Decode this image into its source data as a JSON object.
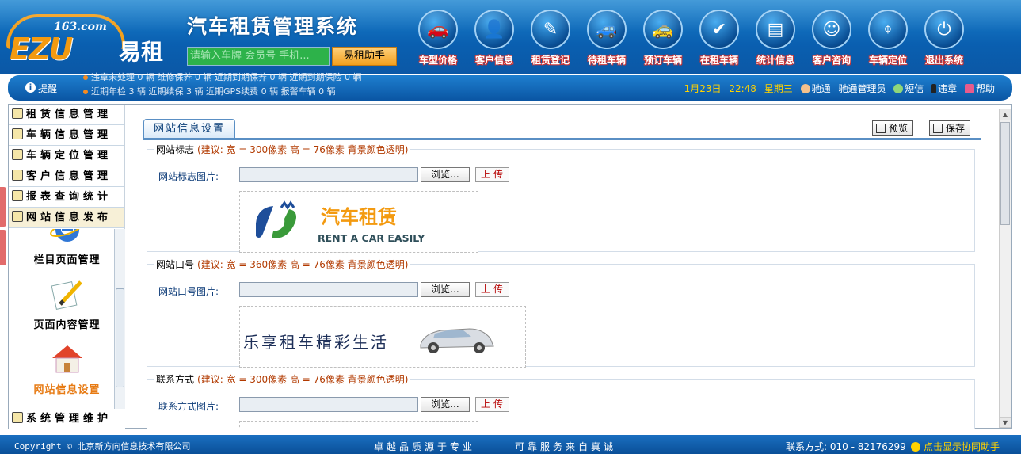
{
  "header": {
    "logo_domain": "163.com",
    "logo_brand": "EZU",
    "logo_name": "易租",
    "system_title": "汽车租赁管理系统",
    "search_placeholder": "请输入车牌 会员号 手机...",
    "helper_button": "易租助手"
  },
  "nav": [
    {
      "label": "车型价格",
      "icon": "car-price-icon"
    },
    {
      "label": "客户信息",
      "icon": "customer-info-icon"
    },
    {
      "label": "租赁登记",
      "icon": "rental-register-icon"
    },
    {
      "label": "待租车辆",
      "icon": "car-waiting-icon"
    },
    {
      "label": "预订车辆",
      "icon": "car-booking-icon"
    },
    {
      "label": "在租车辆",
      "icon": "car-rented-icon"
    },
    {
      "label": "统计信息",
      "icon": "statistics-icon"
    },
    {
      "label": "客户咨询",
      "icon": "consult-icon"
    },
    {
      "label": "车辆定位",
      "icon": "car-locate-icon"
    },
    {
      "label": "退出系统",
      "icon": "exit-icon"
    }
  ],
  "notice": {
    "label": "提醒",
    "line1": "违章未处理 0 辆  维修保养 0 辆  近期到期保养 0 辆  近期到期保险 0 辆",
    "line2": "近期年检 3 辆  近期续保 3 辆  近期GPS续费 0 辆  报警车辆 0 辆",
    "date": "1月23日",
    "time": "22:48",
    "weekday": "星期三",
    "user_org": "驰通",
    "user_name": "驰通管理员",
    "sms": "短信",
    "violation": "违章",
    "help": "帮助"
  },
  "sidebar": {
    "items": [
      "租赁信息管理",
      "车辆信息管理",
      "车辆定位管理",
      "客户信息管理",
      "报表查询统计",
      "网站信息发布"
    ],
    "sub_items": [
      "栏目页面管理",
      "页面内容管理",
      "网站信息设置"
    ],
    "last_item": "系统管理维护"
  },
  "main": {
    "tab": "网站信息设置",
    "preview_btn": "预览",
    "save_btn": "保存",
    "sections": [
      {
        "title": "网站标志",
        "hint": "(建议: 宽 = 300像素 高 = 76像素 背景颜色透明)",
        "field_label": "网站标志图片:"
      },
      {
        "title": "网站口号",
        "hint": "(建议: 宽 = 360像素 高 = 76像素 背景颜色透明)",
        "field_label": "网站口号图片:"
      },
      {
        "title": "联系方式",
        "hint": "(建议: 宽 = 300像素 高 = 76像素 背景颜色透明)",
        "field_label": "联系方式图片:"
      }
    ],
    "browse_label": "浏览...",
    "upload_label": "上传",
    "logo_image_cn": "汽车租赁",
    "logo_image_en": "RENT A CAR EASILY",
    "slogan_image": "乐享租车精彩生活"
  },
  "footer": {
    "copyright": "Copyright © 北京新方向信息技术有限公司",
    "slogan1": "卓越品质源于专业",
    "slogan2": "可靠服务来自真诚",
    "contact": "联系方式: 010 - 82176299",
    "assistant": "点击显示协同助手"
  },
  "colors": {
    "header_blue": "#0a5fb0",
    "brand_orange": "#f39a10",
    "nav_label_outline": "#cc3333",
    "hint_red": "#b23a00"
  }
}
